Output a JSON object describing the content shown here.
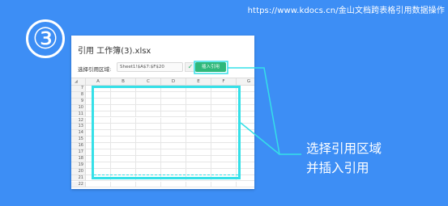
{
  "site_url": "https://www.kdocs.cn/金山文档跨表格引用数据操作",
  "step_number": "③",
  "dialog": {
    "title": "引用 工作簿(3).xlsx",
    "range_label": "选择引用区域:",
    "range_value": "Sheet1!$A$7:$F$20",
    "confirm_icon": "check-icon",
    "insert_button": "插入引用"
  },
  "grid": {
    "corner_glyph": "◢",
    "columns": [
      "A",
      "B",
      "C",
      "D",
      "E",
      "F",
      "G"
    ],
    "rows": [
      "7",
      "8",
      "9",
      "10",
      "11",
      "12",
      "13",
      "14",
      "15",
      "16",
      "17",
      "18",
      "19",
      "20",
      "21",
      "22"
    ]
  },
  "callout": {
    "line1": "选择引用区域",
    "line2": "并插入引用"
  },
  "colors": {
    "background": "#3d8ef5",
    "highlight": "#35e0e8",
    "insert_button": "#2eb87a"
  }
}
